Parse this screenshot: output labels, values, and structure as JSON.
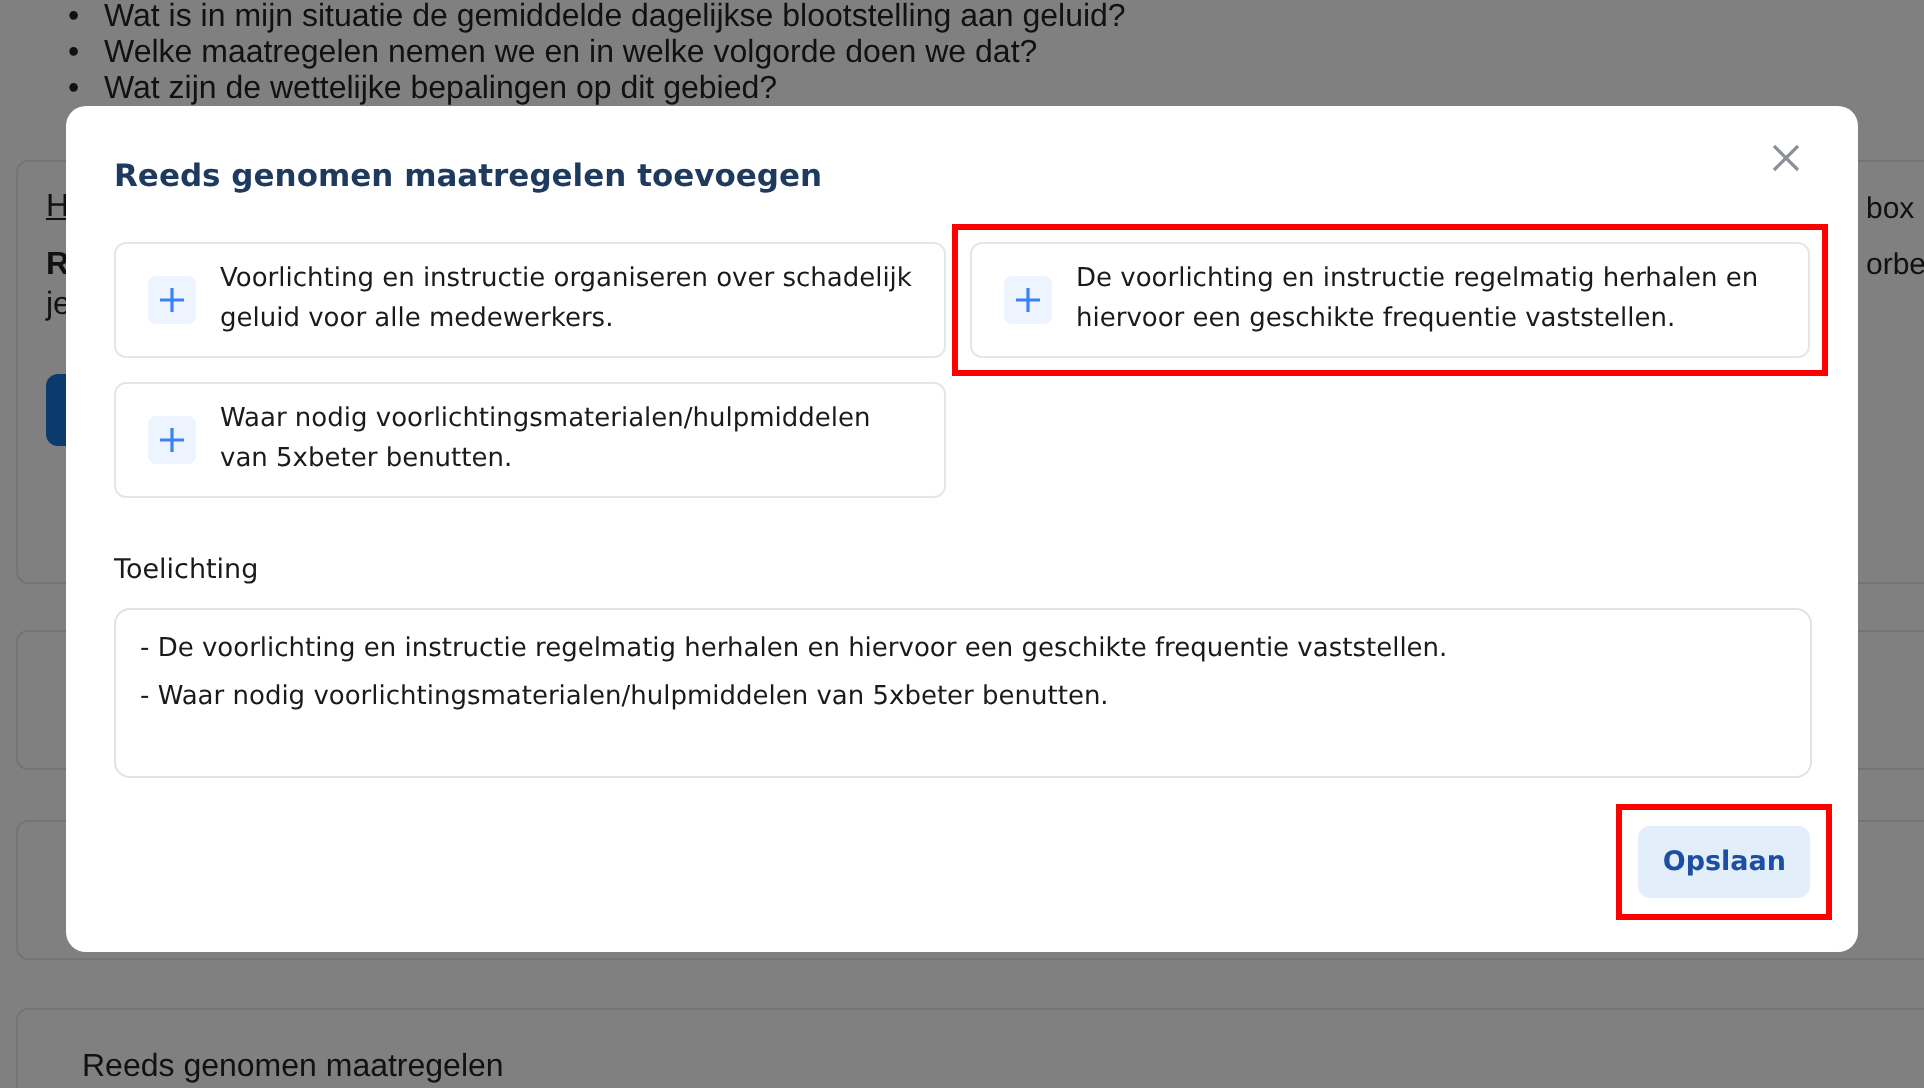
{
  "background_page": {
    "questions": [
      "Wat is in mijn situatie de gemiddelde dagelijkse blootstelling aan geluid?",
      "Welke maatregelen nemen we en in welke volgorde doen we dat?",
      "Wat zijn de wettelijke bepalingen op dit gebied?"
    ],
    "link_fragment": "H",
    "bold_fragment": "R",
    "text_fragment": "je",
    "bullet": "•",
    "right_fragments": [
      "box",
      "orbe"
    ],
    "section_title": "Reeds genomen maatregelen"
  },
  "dialog": {
    "title": "Reeds genomen maatregelen toevoegen",
    "options": [
      {
        "label": "Voorlichting en instructie organiseren over schadelijk geluid voor alle medewerkers.",
        "highlighted": false
      },
      {
        "label": "De voorlichting en instructie regelmatig herhalen en hiervoor een geschikte frequentie vaststellen.",
        "highlighted": true
      },
      {
        "label": "Waar nodig voorlichtingsmaterialen/hulpmiddelen van 5xbeter benutten.",
        "highlighted": false
      }
    ],
    "explanation_label": "Toelichting",
    "explanation_value": "- De voorlichting en instructie regelmatig herhalen en hiervoor een geschikte frequentie vaststellen.\n- Waar nodig voorlichtingsmaterialen/hulpmiddelen van 5xbeter benutten.",
    "save_button": {
      "label": "Opslaan",
      "highlighted": true
    }
  }
}
